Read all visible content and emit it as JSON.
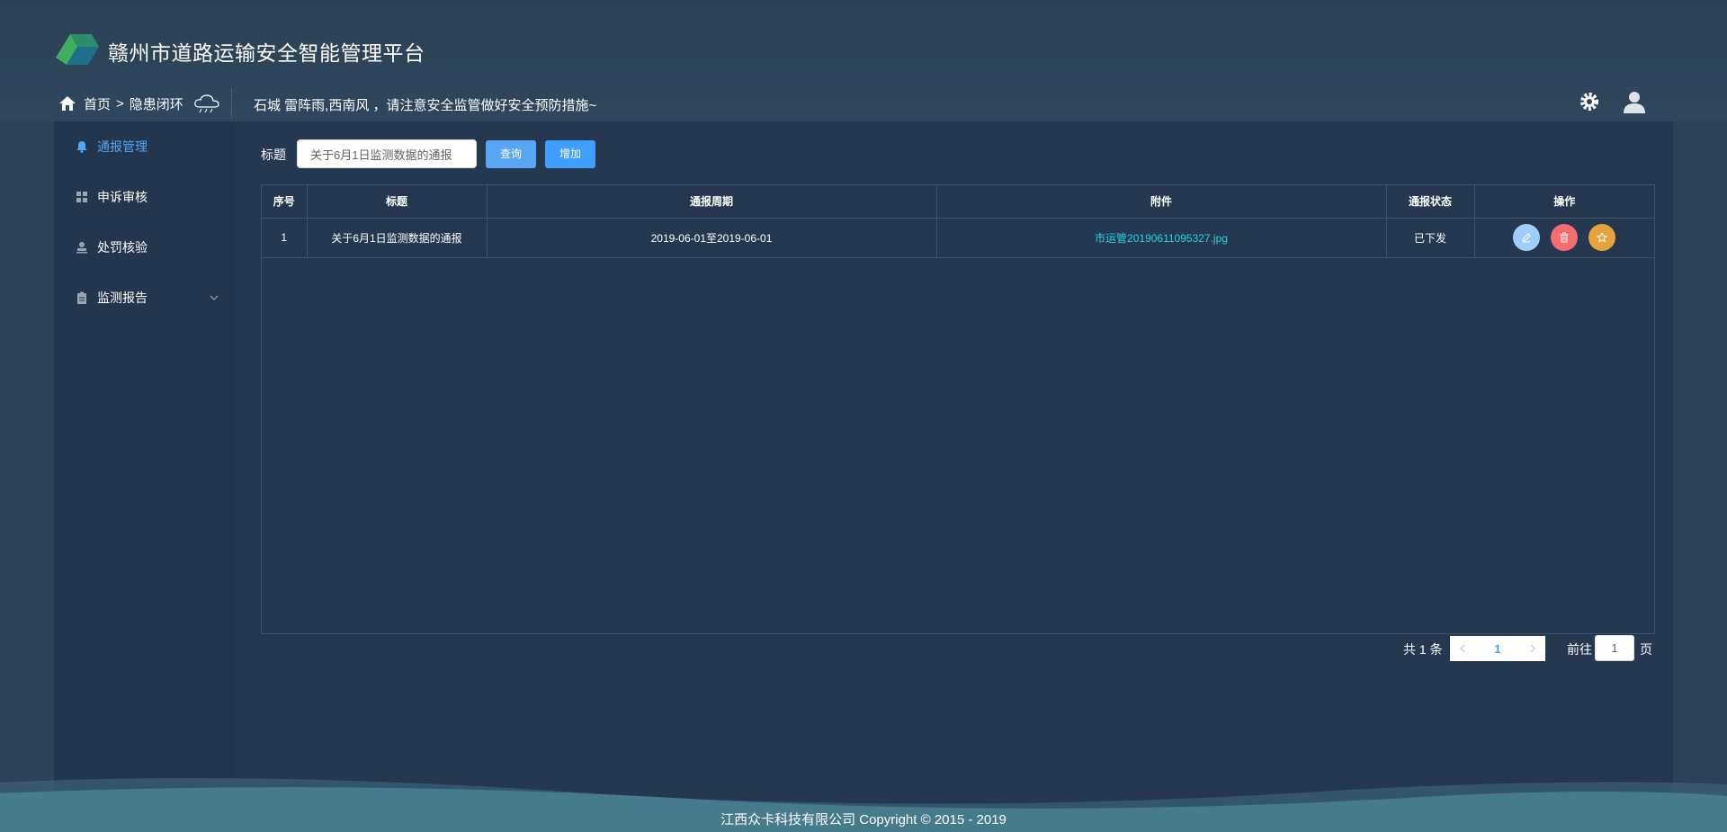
{
  "header": {
    "app_title": "赣州市道路运输安全智能管理平台",
    "breadcrumb_home": "首页",
    "breadcrumb_sep": ">",
    "breadcrumb_current": "隐患闭环",
    "weather_text": "石城 雷阵雨,西南风 ，请注意安全监管做好安全预防措施~"
  },
  "sidebar": {
    "items": [
      {
        "label": "通报管理",
        "icon": "bell-icon",
        "active": true
      },
      {
        "label": "申诉审核",
        "icon": "grid-icon",
        "active": false
      },
      {
        "label": "处罚核验",
        "icon": "user-stamp-icon",
        "active": false
      },
      {
        "label": "监测报告",
        "icon": "clipboard-icon",
        "active": false
      }
    ]
  },
  "search": {
    "label": "标题",
    "value": "关于6月1日监测数据的通报",
    "query_label": "查询",
    "add_label": "增加"
  },
  "table": {
    "columns": [
      "序号",
      "标题",
      "通报周期",
      "附件",
      "通报状态",
      "操作"
    ],
    "rows": [
      {
        "index": "1",
        "title": "关于6月1日监测数据的通报",
        "period": "2019-06-01至2019-06-01",
        "attachment": "市运管20190611095327.jpg",
        "status": "已下发"
      }
    ]
  },
  "pagination": {
    "total": "共 1 条",
    "current_page": "1",
    "goto_label": "前往",
    "goto_value": "1",
    "goto_suffix": "页"
  },
  "footer": {
    "text": "江西众卡科技有限公司 Copyright © 2015 - 2019"
  },
  "colors": {
    "background": "#2d4257",
    "panel": "#263850",
    "accent": "#409eff",
    "link": "#1fd5e0",
    "danger": "#f56c6c",
    "warning": "#e6a23c"
  }
}
